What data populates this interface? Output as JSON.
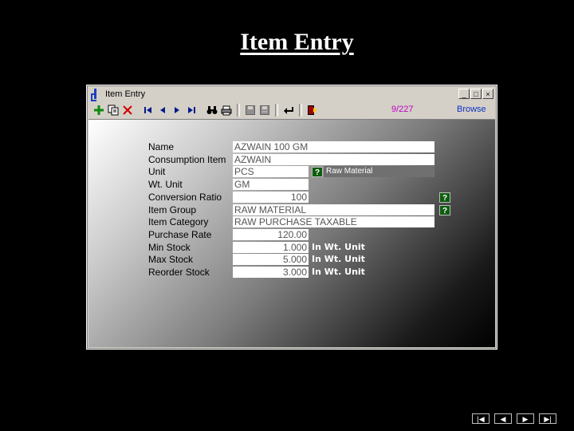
{
  "slide": {
    "title": "Item Entry"
  },
  "window": {
    "title": "Item Entry",
    "controls": [
      "_",
      "□",
      "×"
    ]
  },
  "toolbar": {
    "icons": [
      "add-icon",
      "copy-icon",
      "delete-icon",
      "first-record-icon",
      "previous-record-icon",
      "next-record-icon",
      "last-record-icon",
      "find-icon",
      "print-icon",
      "save-icon",
      "save-disabled-icon",
      "undo-icon",
      "exit-icon"
    ],
    "record_count": "9/227",
    "mode": "Browse"
  },
  "form": {
    "name": {
      "label": "Name",
      "value": "AZWAIN 100 GM"
    },
    "consumption_item": {
      "label": "Consumption Item",
      "value": "AZWAIN"
    },
    "unit": {
      "label": "Unit",
      "value": "PCS",
      "category": "Raw Material"
    },
    "wt_unit": {
      "label": "Wt. Unit",
      "value": "GM"
    },
    "conversion_ratio": {
      "label": "Conversion Ratio",
      "value": "100"
    },
    "item_group": {
      "label": "Item Group",
      "value": "RAW MATERIAL"
    },
    "item_category": {
      "label": "Item Category",
      "value": "RAW PURCHASE TAXABLE"
    },
    "purchase_rate": {
      "label": "Purchase Rate",
      "value": "120.00"
    },
    "min_stock": {
      "label": "Min Stock",
      "value": "1.000",
      "note": "In Wt. Unit"
    },
    "max_stock": {
      "label": "Max Stock",
      "value": "5.000",
      "note": "In Wt. Unit"
    },
    "reorder_stock": {
      "label": "Reorder Stock",
      "value": "3.000",
      "note": "In Wt. Unit"
    },
    "help_symbol": "?"
  },
  "slide_nav": {
    "first": "|◀",
    "prev": "◀",
    "next": "▶",
    "last": "▶|"
  },
  "colors": {
    "help_button": "#0e5d0e",
    "record_count": "#c000c0",
    "mode": "#1030c0"
  }
}
